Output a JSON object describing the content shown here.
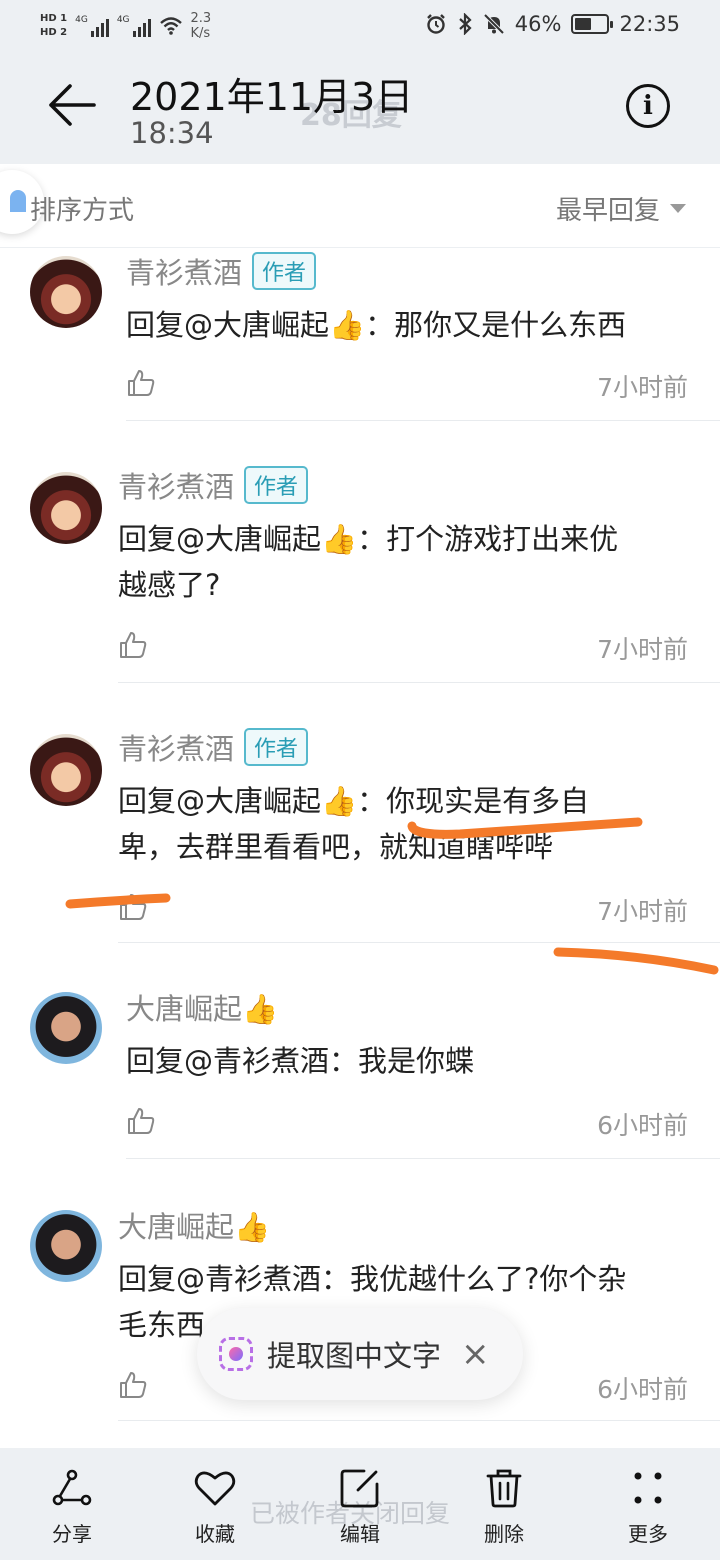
{
  "status_bar": {
    "sim1": "HD 1",
    "sim2": "HD 2",
    "network1": "4G",
    "network2": "4G",
    "speed_value": "2.3",
    "speed_unit": "K/s",
    "battery": "46%",
    "time": "22:35"
  },
  "header": {
    "title": "2021年11月3日",
    "subtitle": "18:34",
    "ghost_title": "28回复"
  },
  "sort": {
    "label": "排序方式",
    "value": "最早回复"
  },
  "replies": [
    {
      "author": "青衫煮酒",
      "badge": "作者",
      "content_line1": "回复@大唐崛起👍：那你又是什么东西",
      "content_line2": "",
      "time": "7小时前"
    },
    {
      "author": "青衫煮酒",
      "badge": "作者",
      "content_line1": "回复@大唐崛起👍：打个游戏打出来优",
      "content_line2": "越感了?",
      "time": "7小时前"
    },
    {
      "author": "青衫煮酒",
      "badge": "作者",
      "content_line1": "回复@大唐崛起👍：你现实是有多自",
      "content_line2": "卑，去群里看看吧，就知道瞎哔哔",
      "time": "7小时前"
    },
    {
      "author": "大唐崛起👍",
      "badge": "",
      "content_line1": "回复@青衫煮酒：我是你蝶",
      "content_line2": "",
      "time": "6小时前"
    },
    {
      "author": "大唐崛起👍",
      "badge": "",
      "content_line1": "回复@青衫煮酒：我优越什么了?你个杂",
      "content_line2": "毛东西",
      "time": "6小时前"
    }
  ],
  "toast": {
    "text": "提取图中文字"
  },
  "bottom_bar": {
    "ghost_text": "已被作者关闭回复",
    "tabs": [
      "分享",
      "收藏",
      "编辑",
      "删除",
      "更多"
    ]
  },
  "colors": {
    "header_bg": "#edf0f3",
    "badge": "#2a9db5",
    "marker": "#f47a2a"
  }
}
